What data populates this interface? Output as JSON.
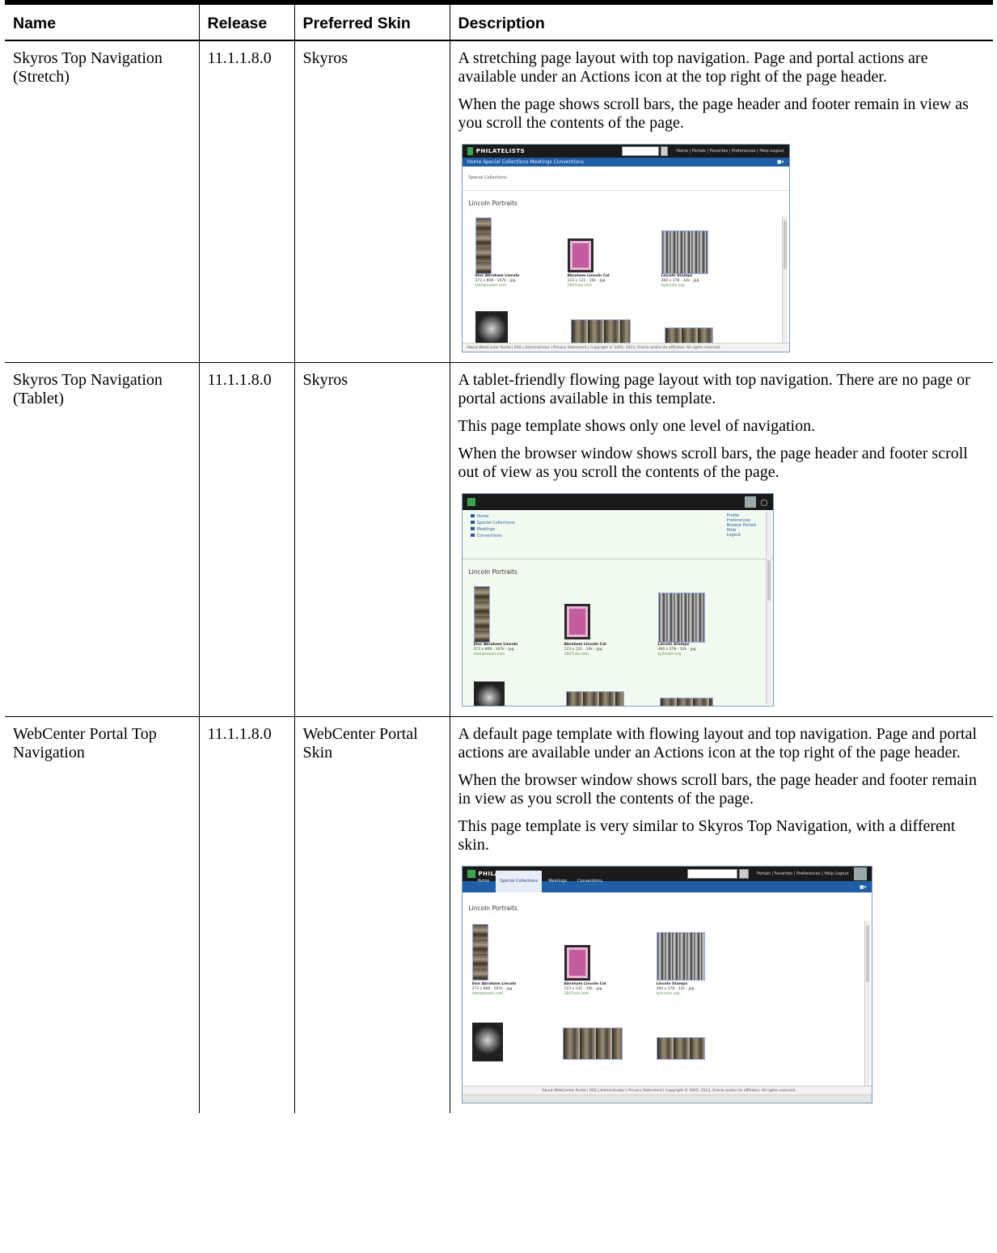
{
  "columns": [
    "Name",
    "Release",
    "Preferred Skin",
    "Description"
  ],
  "rows": [
    {
      "name": "Skyros Top Navigation (Stretch)",
      "release": "11.1.1.8.0",
      "skin": "Skyros",
      "paragraphs": [
        "A stretching page layout with top navigation. Page and portal actions are available under an Actions icon at the top right of the page header.",
        "When the page shows scroll bars, the page header and footer remain in view as you scroll the contents of the page."
      ]
    },
    {
      "name": "Skyros Top Navigation (Tablet)",
      "release": "11.1.1.8.0",
      "skin": "Skyros",
      "paragraphs": [
        "A tablet-friendly flowing page layout with top navigation. There are no page or portal actions available in this template.",
        "This page template shows only one level of navigation.",
        "When the browser window shows scroll bars, the page header and footer scroll out of view as you scroll the contents of the page."
      ]
    },
    {
      "name": "WebCenter Portal Top Navigation",
      "release": "11.1.1.8.0",
      "skin": "WebCenter Portal Skin",
      "paragraphs": [
        "A default page template with flowing layout and top navigation. Page and portal actions are available under an Actions icon at the top right of the page header.",
        "When the browser window shows scroll bars, the page header and footer remain in view as you scroll the contents of the page.",
        "This page template is very similar to Skyros Top Navigation, with a different skin."
      ]
    }
  ],
  "shots": {
    "brand": "PHILATELISTS",
    "page_title": "Lincoln Portraits",
    "crumb": "Special Collections",
    "stretch_links": "Home | Portals | Favorites | Preferences | Help Logout",
    "stretch_nav": "Home  Special Collections  Meetings  Conventions",
    "tablet_left": [
      "Home",
      "Special Collections",
      "Meetings",
      "Conventions"
    ],
    "tablet_right": [
      "Profile",
      "Preferences",
      "Browse Portals",
      "Help",
      "Logout"
    ],
    "webcenter_tabs": [
      "Home",
      "Special Collections",
      "Meetings",
      "Conventions"
    ],
    "webcenter_links": "Portals | Favorites | Preferences | Help Logout",
    "webcenter_footer": "About WebCenter Portal | RSS | Administrator | Privacy Statement | Copyright © 2005, 2013, Oracle and/or its affiliates. All rights reserved.",
    "stretch_footer": "About WebCenter Portal | RSS | Administrator | Privacy Statement | Copyright © 2005, 2013, Oracle and/or its affiliates. All rights reserved.",
    "cap1_title": "Stor Abraham Lincoln",
    "cap1_meta": "373 x 868 - 167k - jpg",
    "cap1_src": "stampnsoon.com",
    "cap2_title": "Abraham Lincoln Col",
    "cap2_meta": "123 x 131 - 10k - jpg",
    "cap2_src": "1847usa.com",
    "cap3_title": "Lincoln Stamps",
    "cap3_meta": "360 x 378 - 32k - jpg",
    "cap3_src": "kylincoln.org"
  }
}
